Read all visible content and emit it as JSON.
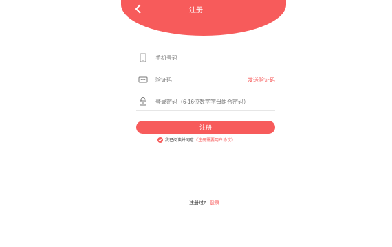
{
  "header": {
    "title": "注册"
  },
  "form": {
    "phone_placeholder": "手机号码",
    "code_placeholder": "验证码",
    "send_code_label": "发送验证码",
    "password_placeholder": "登录密码（6-16位数字字母组合密码）"
  },
  "actions": {
    "register_label": "注册"
  },
  "agreement": {
    "prefix": "我已阅读并同意",
    "link_text": "《注册需要用户协议》"
  },
  "footer": {
    "prompt": "注册过?",
    "login_label": "登录"
  },
  "colors": {
    "accent": "#f75b5b",
    "divider": "#e6e6e6"
  },
  "icons": [
    "chevron-left-icon",
    "phone-icon",
    "message-icon",
    "lock-icon",
    "check-icon"
  ]
}
